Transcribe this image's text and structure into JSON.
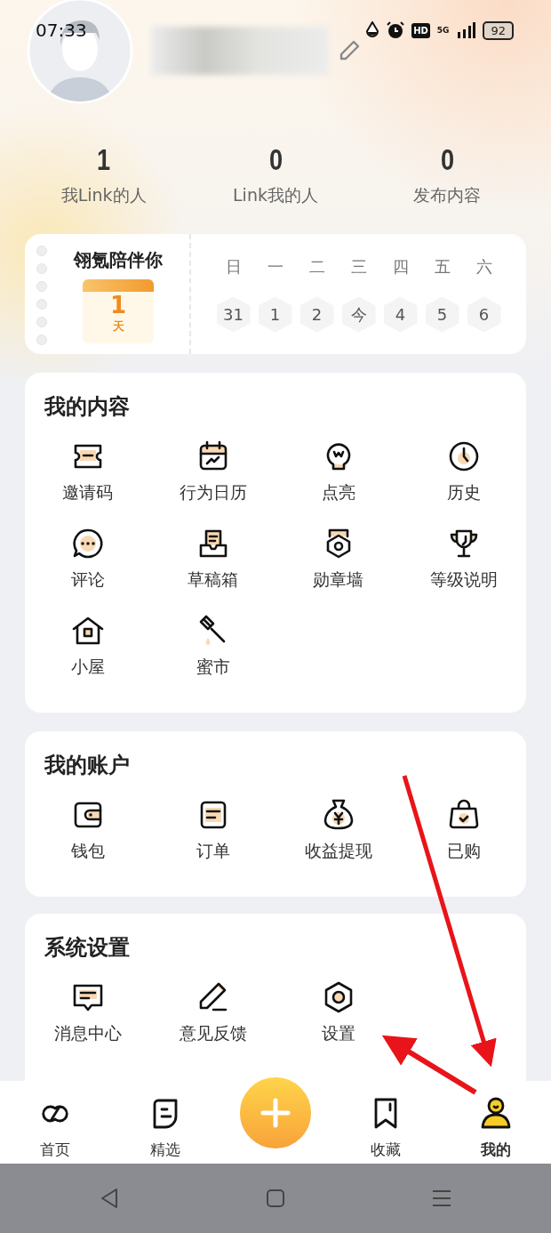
{
  "status_bar": {
    "time": "07:33",
    "hd": "HD",
    "network": "5G",
    "battery": "92"
  },
  "profile": {
    "stats": [
      {
        "value": "1",
        "label": "我Link的人"
      },
      {
        "value": "0",
        "label": "Link我的人"
      },
      {
        "value": "0",
        "label": "发布内容"
      }
    ]
  },
  "companion": {
    "title": "翎氪陪伴你",
    "days": "1",
    "unit": "天",
    "weekdays": [
      "日",
      "一",
      "二",
      "三",
      "四",
      "五",
      "六"
    ],
    "dates": [
      "31",
      "1",
      "2",
      "今",
      "4",
      "5",
      "6"
    ]
  },
  "sections": [
    {
      "title": "我的内容",
      "items": [
        "邀请码",
        "行为日历",
        "点亮",
        "历史",
        "评论",
        "草稿箱",
        "勋章墙",
        "等级说明",
        "小屋",
        "蜜市"
      ]
    },
    {
      "title": "我的账户",
      "items": [
        "钱包",
        "订单",
        "收益提现",
        "已购"
      ]
    },
    {
      "title": "系统设置",
      "items": [
        "消息中心",
        "意见反馈",
        "设置"
      ]
    }
  ],
  "tab_bar": [
    {
      "label": "首页",
      "selected": false
    },
    {
      "label": "精选",
      "selected": false
    },
    {
      "label": "收藏",
      "selected": false
    },
    {
      "label": "我的",
      "selected": true
    }
  ]
}
